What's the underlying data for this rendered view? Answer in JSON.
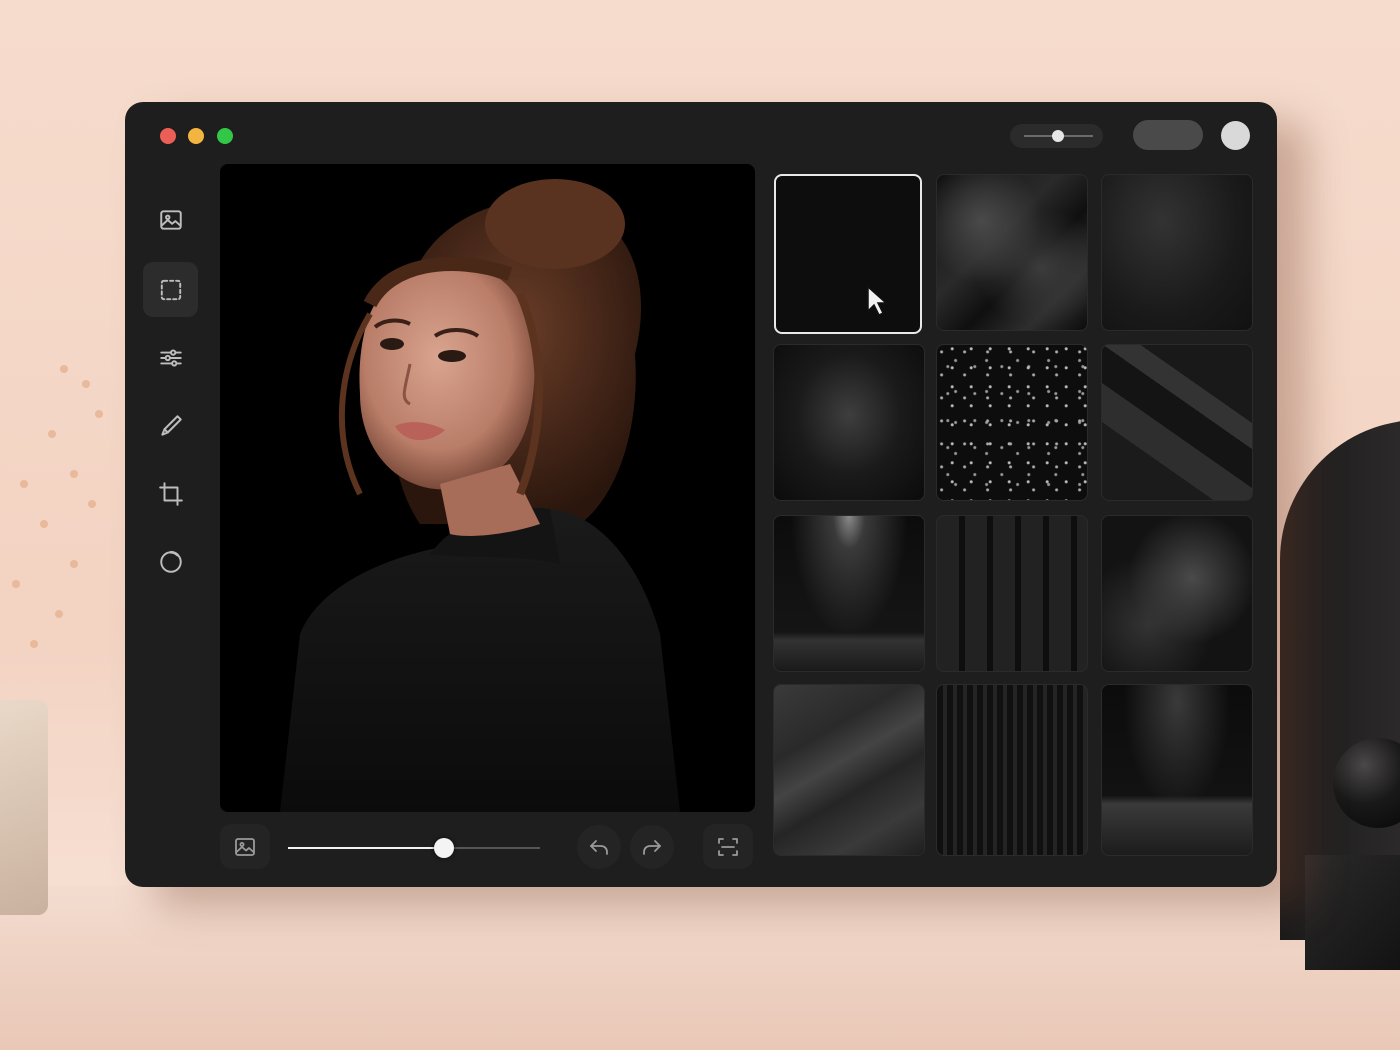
{
  "window": {
    "traffic_lights": {
      "close": "#ec5f57",
      "minimize": "#f3b540",
      "maximize": "#33c748"
    },
    "accent": "#e9e9e9",
    "topbar": {
      "slider_level": 0.5
    }
  },
  "sidebar": {
    "tools": [
      {
        "icon": "image-icon",
        "active": false
      },
      {
        "icon": "selection-icon",
        "active": true
      },
      {
        "icon": "sliders-icon",
        "active": false
      },
      {
        "icon": "brush-icon",
        "active": false
      },
      {
        "icon": "crop-icon",
        "active": false
      },
      {
        "icon": "circle-icon",
        "active": false
      }
    ]
  },
  "canvas": {
    "subject": "portrait photo",
    "background": "#000000"
  },
  "bottom_toolbar": {
    "zoom_level": 0.62
  },
  "backgrounds": {
    "selected_index": 0,
    "tiles": [
      "plain-black",
      "black-silk",
      "dark-texture",
      "radial-glow",
      "starry-dust",
      "crumpled-paper",
      "spotlight-stage",
      "window-shadow",
      "smoke",
      "slate-stone",
      "curtain",
      "studio-floor"
    ]
  }
}
